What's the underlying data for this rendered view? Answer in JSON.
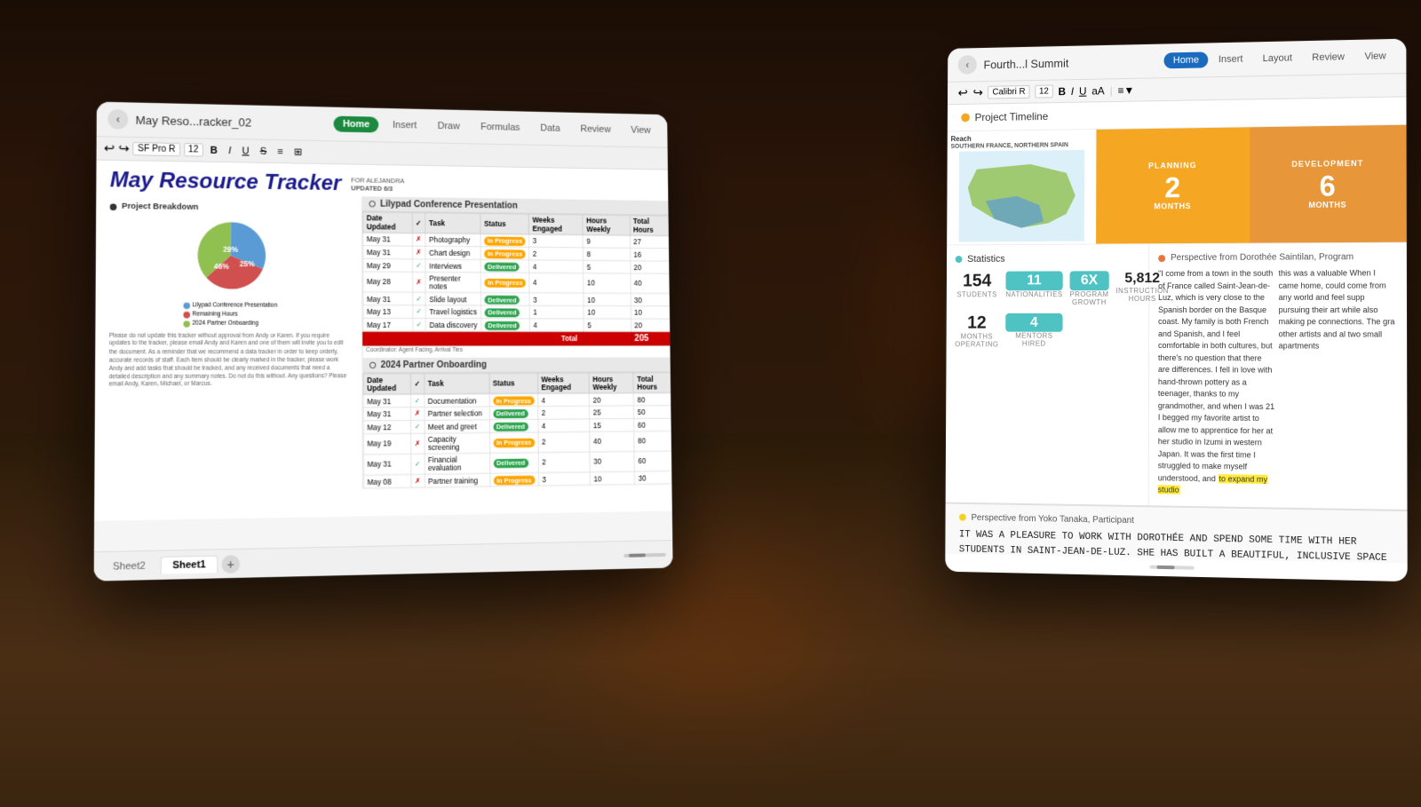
{
  "background": {
    "description": "VR/AR room environment with warm fireplace ambiance"
  },
  "window_left": {
    "title": "May Reso...racker_02",
    "back_label": "‹",
    "tab_home": "Home",
    "tab_insert": "Insert",
    "tab_draw": "Draw",
    "tab_formulas": "Formulas",
    "tab_data": "Data",
    "tab_review": "Review",
    "tab_view": "View",
    "font_name": "SF Pro R",
    "font_size": "12",
    "sheet_title": "May Resource Tracker",
    "for_text": "FOR ALEJANDRA",
    "updated_text": "UPDATED 6/3",
    "section1_title": "Project Breakdown",
    "section2_title": "Lilypad Conference Presentation",
    "section3_title": "2024 Partner Onboarding",
    "table1_headers": [
      "Date Updated",
      "✓",
      "Task",
      "Status",
      "Weeks Engaged",
      "Hours Weekly",
      "Total Hours"
    ],
    "table1_rows": [
      {
        "date": "May 31",
        "check": "✗",
        "task": "Photography",
        "status": "In Progress",
        "weeks": "3",
        "weekly": "9",
        "total": "27"
      },
      {
        "date": "May 31",
        "check": "✗",
        "task": "Chart design",
        "status": "In Progress",
        "weeks": "2",
        "weekly": "8",
        "total": "16"
      },
      {
        "date": "May 29",
        "check": "✓",
        "task": "Interviews",
        "status": "Delivered",
        "weeks": "4",
        "weekly": "5",
        "total": "20"
      },
      {
        "date": "May 28",
        "check": "✗",
        "task": "Presenter notes",
        "status": "In Progress",
        "weeks": "4",
        "weekly": "10",
        "total": "40"
      },
      {
        "date": "May 31",
        "check": "✓",
        "task": "Slide layout",
        "status": "Delivered",
        "weeks": "3",
        "weekly": "10",
        "total": "30"
      },
      {
        "date": "May 13",
        "check": "✓",
        "task": "Travel logistics",
        "status": "Delivered",
        "weeks": "1",
        "weekly": "10",
        "total": "10"
      },
      {
        "date": "May 17",
        "check": "✓",
        "task": "Data discovery",
        "status": "Delivered",
        "weeks": "4",
        "weekly": "5",
        "total": "20"
      }
    ],
    "total_label": "Total",
    "total_value": "205",
    "table2_headers": [
      "Date Updated",
      "✓",
      "Task",
      "Status",
      "Weeks Engaged",
      "Hours Weekly",
      "Total Hours"
    ],
    "table2_rows": [
      {
        "date": "May 31",
        "check": "✓",
        "task": "Documentation",
        "status": "In Progress",
        "weeks": "4",
        "weekly": "20",
        "total": "80"
      },
      {
        "date": "May 31",
        "check": "✗",
        "task": "Partner selection",
        "status": "Delivered",
        "weeks": "2",
        "weekly": "25",
        "total": "50"
      },
      {
        "date": "May 12",
        "check": "✓",
        "task": "Meet and greet",
        "status": "Delivered",
        "weeks": "4",
        "weekly": "15",
        "total": "60"
      },
      {
        "date": "May 19",
        "check": "✗",
        "task": "Capacity screening",
        "status": "In Progress",
        "weeks": "2",
        "weekly": "40",
        "total": "80"
      },
      {
        "date": "May 31",
        "check": "✓",
        "task": "Financial evaluation",
        "status": "Delivered",
        "weeks": "2",
        "weekly": "30",
        "total": "60"
      },
      {
        "date": "May 08",
        "check": "✗",
        "task": "Partner training",
        "status": "In Progress",
        "weeks": "3",
        "weekly": "10",
        "total": "30"
      }
    ],
    "pie_labels": [
      "46%",
      "29%",
      "25%"
    ],
    "pie_colors": [
      "#5b9bd5",
      "#d05050",
      "#90c050"
    ],
    "pie_legend": [
      {
        "label": "Lilypad Conference Presentation",
        "color": "#5b9bd5"
      },
      {
        "label": "Remaining Hours",
        "color": "#d05050"
      },
      {
        "label": "2024 Partner Onboarding",
        "color": "#90c050"
      }
    ],
    "sheet_tabs": [
      "Sheet2",
      "Sheet1"
    ],
    "active_sheet": "Sheet1",
    "add_sheet": "+"
  },
  "window_right": {
    "back_label": "‹",
    "title": "Fourth...l Summit",
    "tabs": [
      "Home",
      "Insert",
      "Layout",
      "Review",
      "View"
    ],
    "active_tab": "Home",
    "font": "Calibri R",
    "font_size": "12",
    "format_bold": "B",
    "format_italic": "I",
    "format_underline": "U",
    "timeline_title": "Project Timeline",
    "regions": {
      "reach_label": "Reach",
      "reach_subtext": "SOUTHERN FRANCE, NORTHERN SPAIN",
      "planning_label": "PLANNING",
      "planning_months": "2",
      "planning_unit": "Months",
      "development_label": "DEVELOPMENT",
      "development_months": "6",
      "development_unit": "Months"
    },
    "stats": {
      "header": "Statistics",
      "students_value": "154",
      "students_label": "STUDENTS",
      "nationalities_value": "11",
      "nationalities_label": "NATIONALITIES",
      "growth_value": "6X",
      "growth_label": "PROGRAM GROWTH",
      "hours_value": "5,812",
      "hours_label": "INSTRUCTION HOURS",
      "months_value": "12",
      "months_label": "MONTHS OPERATING",
      "mentors_value": "4",
      "mentors_label": "MENTORS HIRED"
    },
    "perspective": {
      "header": "Perspective from Dorothée Saintilan, Program",
      "dot_color": "#e8763a",
      "text": "\"I come from a town in the south of France called Saint-Jean-de-Luz, which is very close to the Spanish border on the Basque coast. My family is both French and Spanish, and I feel comfortable in both cultures, but there's no question that there are differences. I fell in love with hand-thrown pottery as a teenager, thanks to my grandmother, and when I was 21 I begged my favorite artist to allow me to apprentice for her at her studio in Izumi in western Japan. It was the first time I struggled to make myself understood, and",
      "highlight": "to expand my studio",
      "text_continued": "this was a valuable When I came home, could come from any world and feel supp pursuing their art while also making pe connections. The gra other artists and al two small apartments"
    },
    "yoko": {
      "header": "Perspective from Yoko Tanaka, Participant",
      "dot_color": "#f5d020",
      "quote": "IT WAS A PLEASURE TO WORK WITH DOROTHÉE AND SPEND SOME TIME WITH HER STUDENTS IN SAINT-JEAN-DE-LUZ. SHE HAS BUILT A BEAUTIFUL, INCLUSIVE SPACE FOR YOUNG PEOPLE TO EXPLORE THEIR CRAFT. IN TEACHING DOROTHÉE, MY OWN PROCESS, TOO.\""
    }
  }
}
